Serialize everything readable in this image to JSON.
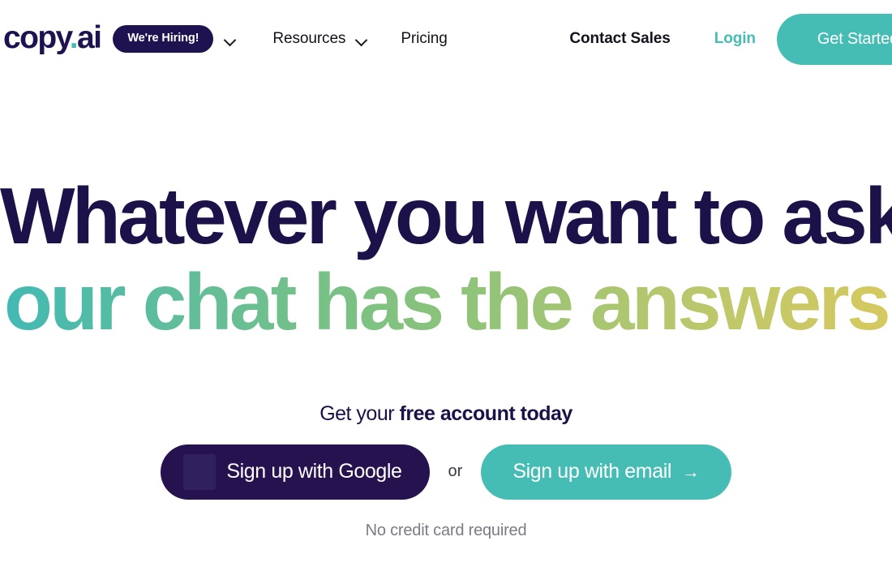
{
  "brand": {
    "logo_main": "copy",
    "logo_dot": ".",
    "logo_suffix": "ai",
    "accent_teal": "#45bdb4",
    "navy": "#1e1250",
    "dark_purple": "#26124f"
  },
  "navbar": {
    "hiring_badge": "We're Hiring!",
    "hiring_chevron": "chevron-down-icon",
    "items": [
      {
        "label": "Resources",
        "has_chevron": true
      },
      {
        "label": "Pricing",
        "has_chevron": false
      }
    ],
    "contact_sales": "Contact Sales",
    "login": "Login",
    "get_started": "Get Started"
  },
  "hero": {
    "headline_line1": "Whatever you want to ask,",
    "headline_line2": "our chat has the answers",
    "headline_gradient_from": "#42b9b4",
    "headline_gradient_mid": "#93c478",
    "headline_gradient_to": "#d6c95f",
    "subhead_regular": "Get your ",
    "subhead_bold": "free account today",
    "cta_google": "Sign up with Google",
    "cta_google_icon": "google-logo-icon",
    "or": "or",
    "cta_email": "Sign up with email",
    "cta_email_arrow": "→",
    "footnote": "No credit card required"
  }
}
